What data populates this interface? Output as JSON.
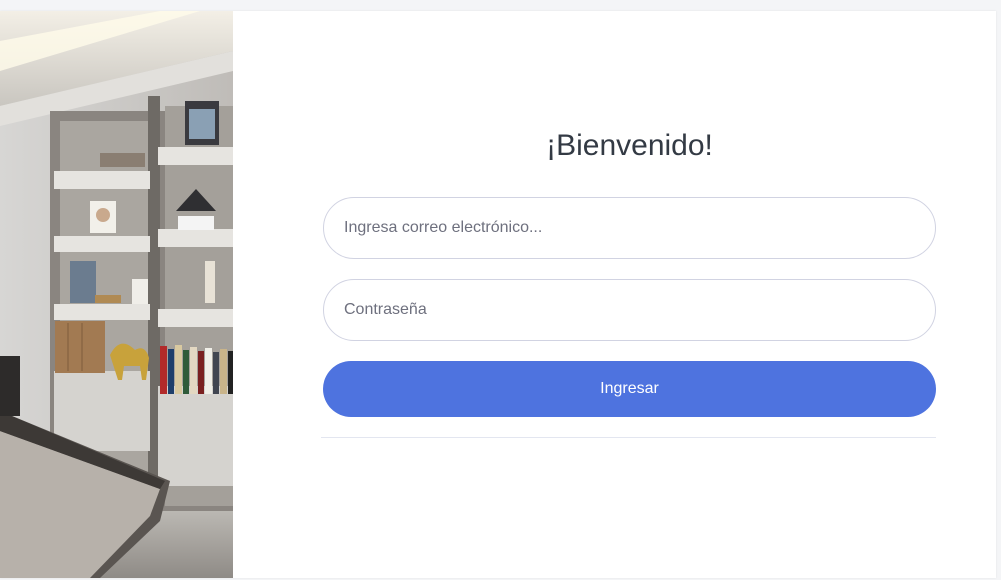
{
  "login": {
    "title": "¡Bienvenido!",
    "email_placeholder": "Ingresa correo electrónico...",
    "password_placeholder": "Contraseña",
    "submit_label": "Ingresar"
  },
  "photo": {
    "alt": "office-bookshelf-photo"
  },
  "colors": {
    "accent": "#4e73df",
    "background": "#f4f5f7",
    "card": "#ffffff"
  }
}
